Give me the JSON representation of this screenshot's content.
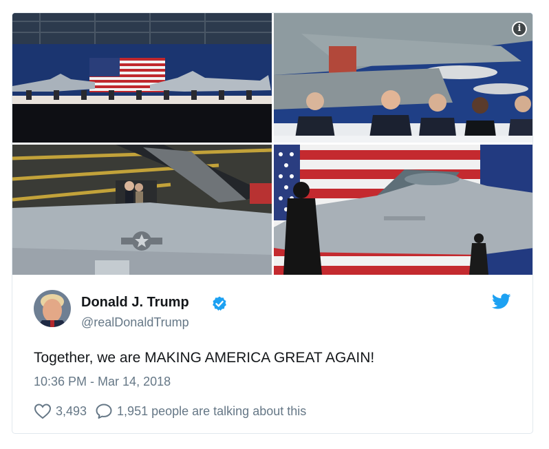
{
  "tweet": {
    "author_name": "Donald J. Trump",
    "handle": "@realDonaldTrump",
    "text": "Together, we are MAKING AMERICA GREAT AGAIN!",
    "timestamp": "10:36 PM - Mar 14, 2018",
    "likes": "3,493",
    "talking": "1,951 people are talking about this"
  },
  "media": {
    "photos": [
      {
        "name": "hangar-event-with-flag-and-jets"
      },
      {
        "name": "panel-table-with-speakers"
      },
      {
        "name": "jet-cockpit-inspection"
      },
      {
        "name": "silhouette-in-front-of-jet-and-flag"
      }
    ],
    "info_icon": "info-icon"
  },
  "icons": {
    "verified": "verified-badge-icon",
    "bird": "twitter-bird-icon",
    "like": "heart-icon",
    "reply": "speech-bubble-icon"
  },
  "colors": {
    "text": "#14171a",
    "muted": "#657786",
    "twitter_blue": "#1da1f2",
    "border": "#e1e8ed"
  }
}
